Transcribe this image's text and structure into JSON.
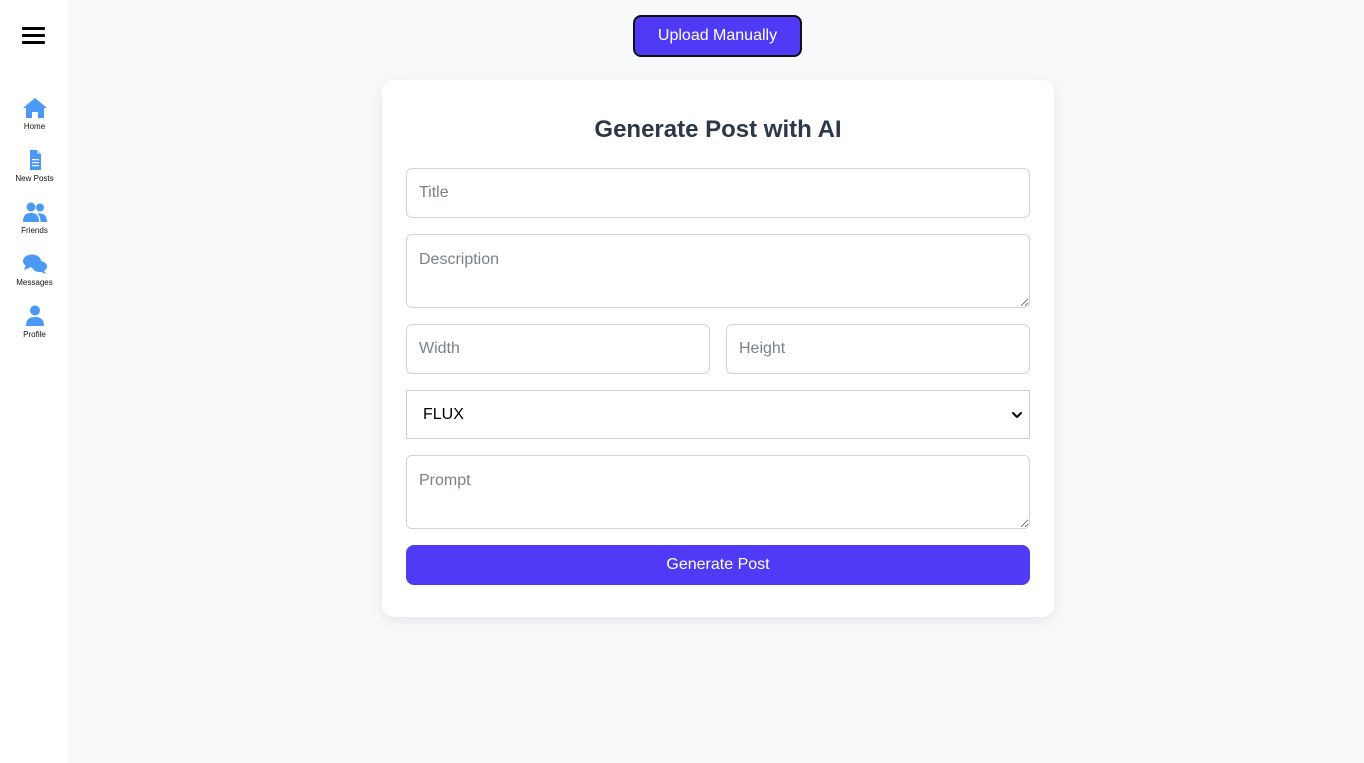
{
  "sidebar": {
    "items": [
      {
        "label": "Home",
        "icon": "home-icon"
      },
      {
        "label": "New Posts",
        "icon": "document-icon"
      },
      {
        "label": "Friends",
        "icon": "users-icon"
      },
      {
        "label": "Messages",
        "icon": "chat-icon"
      },
      {
        "label": "Profile",
        "icon": "user-icon"
      }
    ]
  },
  "header": {
    "upload_label": "Upload Manually"
  },
  "form": {
    "title": "Generate Post with AI",
    "title_placeholder": "Title",
    "description_placeholder": "Description",
    "width_placeholder": "Width",
    "height_placeholder": "Height",
    "model_selected": "FLUX",
    "prompt_placeholder": "Prompt",
    "submit_label": "Generate Post"
  },
  "colors": {
    "accent": "#4f3bf5",
    "icon": "#4a9af5",
    "background": "#f8f9fb"
  }
}
